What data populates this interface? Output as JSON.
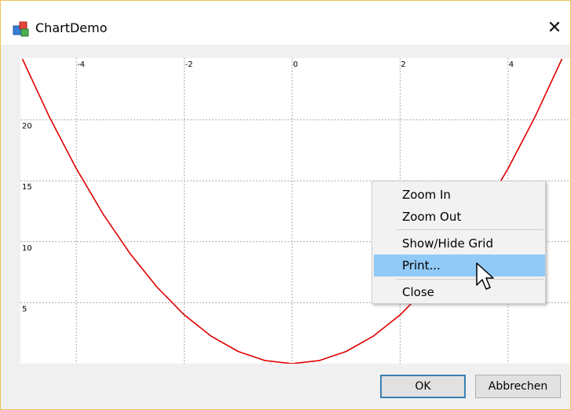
{
  "window": {
    "title": "ChartDemo",
    "close_glyph": "✕"
  },
  "chart_data": {
    "type": "line",
    "x_ticks": [
      "-4",
      "-2",
      "0",
      "2",
      "4"
    ],
    "y_ticks": [
      "20",
      "15",
      "10",
      "5"
    ],
    "xlim": [
      -5.1,
      5.1
    ],
    "ylim": [
      0,
      25
    ],
    "grid": true,
    "series": [
      {
        "color": "#e00000",
        "x": [
          -5,
          -4.5,
          -4,
          -3.5,
          -3,
          -2.5,
          -2,
          -1.5,
          -1,
          -0.5,
          0,
          0.5,
          1,
          1.5,
          2,
          2.5,
          3,
          3.5,
          4,
          4.5,
          5
        ],
        "y": [
          25,
          20.25,
          16,
          12.25,
          9,
          6.25,
          4,
          2.25,
          1,
          0.25,
          0,
          0.25,
          1,
          2.25,
          4,
          6.25,
          9,
          12.25,
          16,
          20.25,
          25
        ]
      }
    ]
  },
  "context_menu": {
    "items": [
      {
        "label": "Zoom In"
      },
      {
        "label": "Zoom Out"
      },
      {
        "label": "Show/Hide Grid"
      },
      {
        "label": "Print..."
      },
      {
        "label": "Close"
      }
    ]
  },
  "buttons": {
    "ok_label": "OK",
    "cancel_label": "Abbrechen"
  },
  "colors": {
    "curve": "#e00000",
    "menu_highlight": "#91c9f7",
    "window_border": "#e8c35a",
    "grid": "#aaaaaa"
  }
}
